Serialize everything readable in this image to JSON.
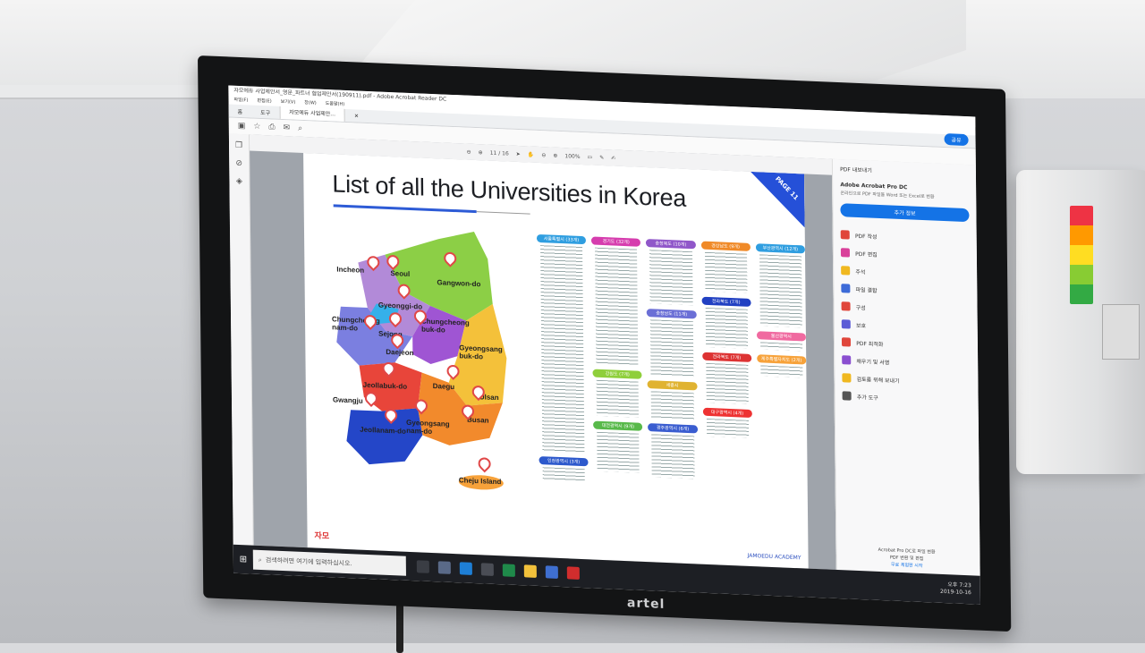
{
  "window": {
    "title": "자모에듀 사업제안서_영문_파트너 협업제안서(190911).pdf - Adobe Acrobat Reader DC",
    "menu": [
      "파일(F)",
      "편집(E)",
      "보기(V)",
      "창(W)",
      "도움말(H)"
    ],
    "tabs": [
      "홈",
      "도구"
    ],
    "doc_tab": "자모에듀 사업제안...",
    "page_indicator": "11 / 16",
    "zoom": "100%"
  },
  "document": {
    "title": "List of all the Universities in Korea",
    "ribbon": "PAGE 11",
    "logo_text": "자모",
    "footer": "JAMOEDU ACADEMY",
    "map_labels": [
      "Incheon",
      "Seoul",
      "Gangwon-do",
      "Gyeonggi-do",
      "Chungcheong nam-do",
      "Sejong",
      "Chungcheong buk-do",
      "Daejeon",
      "Gyeongsang buk-do",
      "Jeollabuk-do",
      "Daegu",
      "Ulsan",
      "Gwangju",
      "Busan",
      "Gyeongsang nam-do",
      "Jeollanam-do",
      "Cheju Island"
    ],
    "groups": [
      {
        "label": "서울특별시 (33개)",
        "color": "#2f9ee0"
      },
      {
        "label": "인천광역시 (3개)",
        "color": "#2d59cc"
      },
      {
        "label": "경기도 (32개)",
        "color": "#d63dae"
      },
      {
        "label": "강원도 (7개)",
        "color": "#8fcf3b"
      },
      {
        "label": "대전광역시 (9개)",
        "color": "#58b94a"
      },
      {
        "label": "충청북도 (10개)",
        "color": "#9057c9"
      },
      {
        "label": "충청남도 (11개)",
        "color": "#6b6fd6"
      },
      {
        "label": "세종시",
        "color": "#e0b331"
      },
      {
        "label": "광주광역시 (6개)",
        "color": "#3a5dd0"
      },
      {
        "label": "경상남도 (9개)",
        "color": "#f08a28"
      },
      {
        "label": "전라북도 (7개)",
        "color": "#2140c2"
      },
      {
        "label": "전라북도 (7개)",
        "color": "#d33"
      },
      {
        "label": "대구광역시 (4개)",
        "color": "#e33"
      },
      {
        "label": "부산광역시 (12개)",
        "color": "#2f9ee0"
      },
      {
        "label": "울산광역시",
        "color": "#f06aa0"
      },
      {
        "label": "제주특별자치도 (2개)",
        "color": "#f7a23a"
      }
    ]
  },
  "right_panel": {
    "share": "공유",
    "export": "PDF 내보내기",
    "product": "Adobe Acrobat Pro DC",
    "product_desc": "온라인으로 PDF 파일을 Word 또는 Excel로 변환",
    "more_button": "추가 정보",
    "tools": [
      {
        "label": "PDF 작성",
        "color": "#e0463b"
      },
      {
        "label": "PDF 편집",
        "color": "#d9409a"
      },
      {
        "label": "주석",
        "color": "#f0b820"
      },
      {
        "label": "파일 결합",
        "color": "#3d6bd8"
      },
      {
        "label": "구성",
        "color": "#e0463b"
      },
      {
        "label": "보호",
        "color": "#5b5bd6"
      },
      {
        "label": "PDF 최적화",
        "color": "#e0463b"
      },
      {
        "label": "채우기 및 서명",
        "color": "#8a4fd0"
      },
      {
        "label": "검토를 위해 보내기",
        "color": "#f0b820"
      },
      {
        "label": "추가 도구",
        "color": "#555555"
      }
    ],
    "promo_line1": "Acrobat Pro DC로 파일 변환",
    "promo_line2": "PDF 변환 및 편집",
    "promo_link": "무료 체험판 시작"
  },
  "taskbar": {
    "search_placeholder": "검색하려면 여기에 입력하십시오.",
    "time": "오후 7:23",
    "date": "2019-10-16"
  },
  "tv_brand": "artel"
}
